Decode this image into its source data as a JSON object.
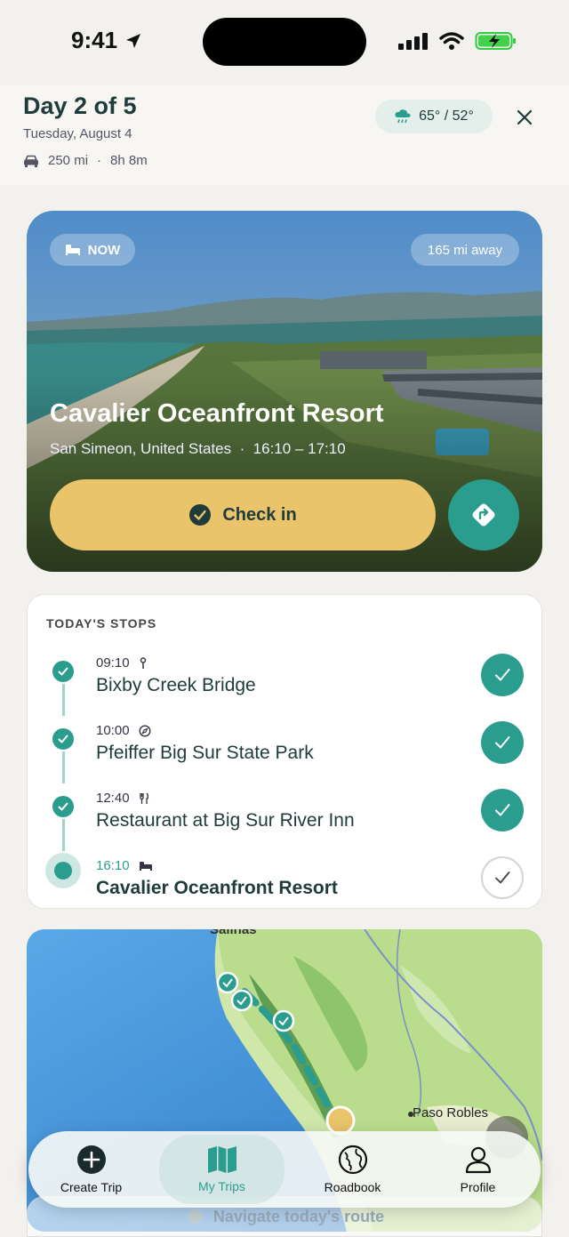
{
  "status": {
    "time": "9:41"
  },
  "header": {
    "day_title": "Day 2 of 5",
    "date": "Tuesday, August 4",
    "distance": "250 mi",
    "separator": "·",
    "duration": "8h 8m",
    "weather": "65° / 52°"
  },
  "hero": {
    "badge": "NOW",
    "distance_away": "165 mi away",
    "title": "Cavalier Oceanfront Resort",
    "subtitle": "San Simeon, United States  ·  16:10 – 17:10",
    "checkin_label": "Check in"
  },
  "stops": {
    "title": "TODAY'S STOPS",
    "items": [
      {
        "time": "09:10",
        "name": "Bixby Creek Bridge",
        "icon": "pin-icon",
        "done": true
      },
      {
        "time": "10:00",
        "name": "Pfeiffer Big Sur State Park",
        "icon": "compass-icon",
        "done": true
      },
      {
        "time": "12:40",
        "name": "Restaurant at Big Sur River Inn",
        "icon": "utensils-icon",
        "done": true
      },
      {
        "time": "16:10",
        "name": "Cavalier Oceanfront Resort",
        "icon": "bed-icon",
        "done": false
      }
    ]
  },
  "map": {
    "label_top": "Salinas",
    "label_city": "Paso Robles"
  },
  "tabs": [
    {
      "label": "Create Trip",
      "icon": "plus-circle-icon"
    },
    {
      "label": "My Trips",
      "icon": "map-icon"
    },
    {
      "label": "Roadbook",
      "icon": "globe-icon"
    },
    {
      "label": "Profile",
      "icon": "person-icon"
    }
  ],
  "navigate_label": "Navigate today's route",
  "colors": {
    "accent": "#2a9d8f",
    "checkin": "#e9c46a",
    "text": "#1f3b3a"
  }
}
